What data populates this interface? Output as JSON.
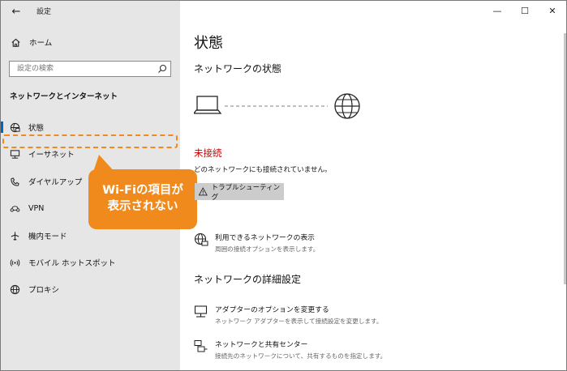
{
  "window": {
    "app_title": "設定",
    "controls": {
      "minimize": "—",
      "maximize": "☐",
      "close": "✕"
    }
  },
  "sidebar": {
    "home_label": "ホーム",
    "search_placeholder": "設定の検索",
    "section_heading": "ネットワークとインターネット",
    "items": [
      {
        "label": "状態",
        "icon": "status-icon",
        "selected": true
      },
      {
        "label": "イーサネット",
        "icon": "ethernet-icon"
      },
      {
        "label": "ダイヤルアップ",
        "icon": "dialup-icon"
      },
      {
        "label": "VPN",
        "icon": "vpn-icon"
      },
      {
        "label": "機内モード",
        "icon": "airplane-icon"
      },
      {
        "label": "モバイル ホットスポット",
        "icon": "hotspot-icon"
      },
      {
        "label": "プロキシ",
        "icon": "globe-icon"
      }
    ]
  },
  "annotation": {
    "callout_line1": "Wi-Fiの項目が",
    "callout_line2": "表示されない",
    "color": "#f08a1c"
  },
  "main": {
    "page_title": "状態",
    "status_heading": "ネットワークの状態",
    "state_text": "未接続",
    "state_color": "#c00000",
    "state_description": "どのネットワークにも接続されていません。",
    "troubleshoot_label": "トラブルシューティング",
    "available_networks": {
      "title": "利用できるネットワークの表示",
      "desc": "周囲の接続オプションを表示します。"
    },
    "advanced_heading": "ネットワークの詳細設定",
    "adapter_options": {
      "title": "アダプターのオプションを変更する",
      "desc": "ネットワーク アダプターを表示して接続設定を変更します。"
    },
    "sharing_center": {
      "title": "ネットワークと共有センター",
      "desc": "接続先のネットワークについて、共有するものを指定します。"
    }
  }
}
